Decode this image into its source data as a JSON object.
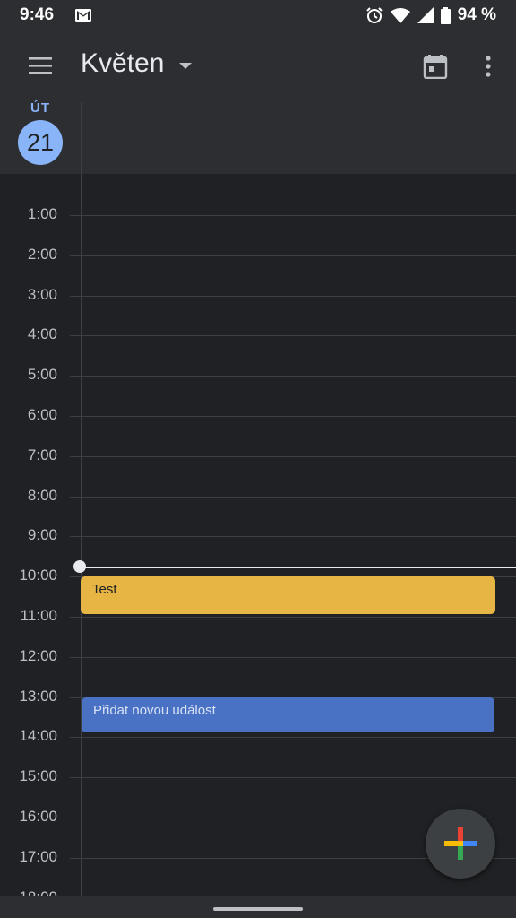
{
  "status_bar": {
    "time": "9:46",
    "battery": "94 %"
  },
  "header": {
    "month": "Květen"
  },
  "day": {
    "abbr": "ÚT",
    "number": "21"
  },
  "hours": [
    "1:00",
    "2:00",
    "3:00",
    "4:00",
    "5:00",
    "6:00",
    "7:00",
    "8:00",
    "9:00",
    "10:00",
    "11:00",
    "12:00",
    "13:00",
    "14:00",
    "15:00",
    "16:00",
    "17:00",
    "18:00"
  ],
  "events": [
    {
      "title": "Test",
      "color": "#e6b544"
    },
    {
      "title": "Přidat novou událost",
      "color": "#4a72c4"
    }
  ],
  "colors": {
    "accent": "#8ab4f8",
    "background": "#202124",
    "surface": "#2d2e31"
  },
  "icons": {
    "menu": "menu-icon",
    "today": "calendar-today-icon",
    "more": "more-vert-icon",
    "fab": "google-plus-icon"
  }
}
